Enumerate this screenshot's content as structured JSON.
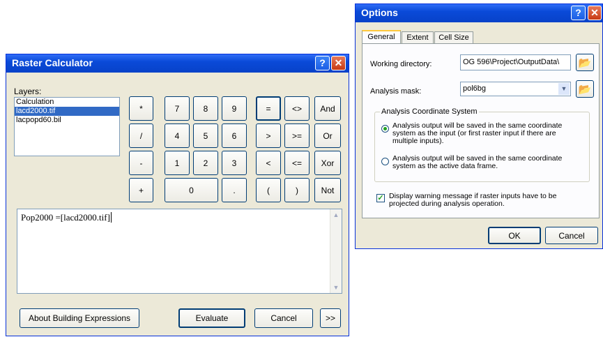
{
  "raster": {
    "title": "Raster Calculator",
    "layers_label": "Layers:",
    "layers": [
      "Calculation",
      "lacd2000.tif",
      "lacpopd60.bil"
    ],
    "selected_layer_index": 1,
    "keys": {
      "multiply": "*",
      "divide": "/",
      "minus": "-",
      "plus": "+",
      "n7": "7",
      "n8": "8",
      "n9": "9",
      "n4": "4",
      "n5": "5",
      "n6": "6",
      "n1": "1",
      "n2": "2",
      "n3": "3",
      "n0": "0",
      "dot": ".",
      "eq": "=",
      "ne": "<>",
      "gt": ">",
      "ge": ">=",
      "lt": "<",
      "le": "<=",
      "lparen": "(",
      "rparen": ")",
      "and": "And",
      "or": "Or",
      "xor": "Xor",
      "not": "Not"
    },
    "expression": "Pop2000 =[lacd2000.tif]",
    "about_label": "About Building Expressions",
    "evaluate_label": "Evaluate",
    "cancel_label": "Cancel",
    "more_label": ">>"
  },
  "options": {
    "title": "Options",
    "tabs": [
      "General",
      "Extent",
      "Cell Size"
    ],
    "active_tab": "General",
    "working_dir_label": "Working directory:",
    "working_dir_value": "OG 596\\Project\\OutputData\\",
    "mask_label": "Analysis mask:",
    "mask_value": "pol6bg",
    "group_title": "Analysis Coordinate System",
    "radio1_label": "Analysis output will be saved in the same coordinate system as the input (or first raster input if there are multiple inputs).",
    "radio2_label": "Analysis output will be saved in the same coordinate system as the active data frame.",
    "check_label": "Display warning message if raster inputs have to be projected during analysis operation.",
    "ok_label": "OK",
    "cancel_label": "Cancel"
  }
}
